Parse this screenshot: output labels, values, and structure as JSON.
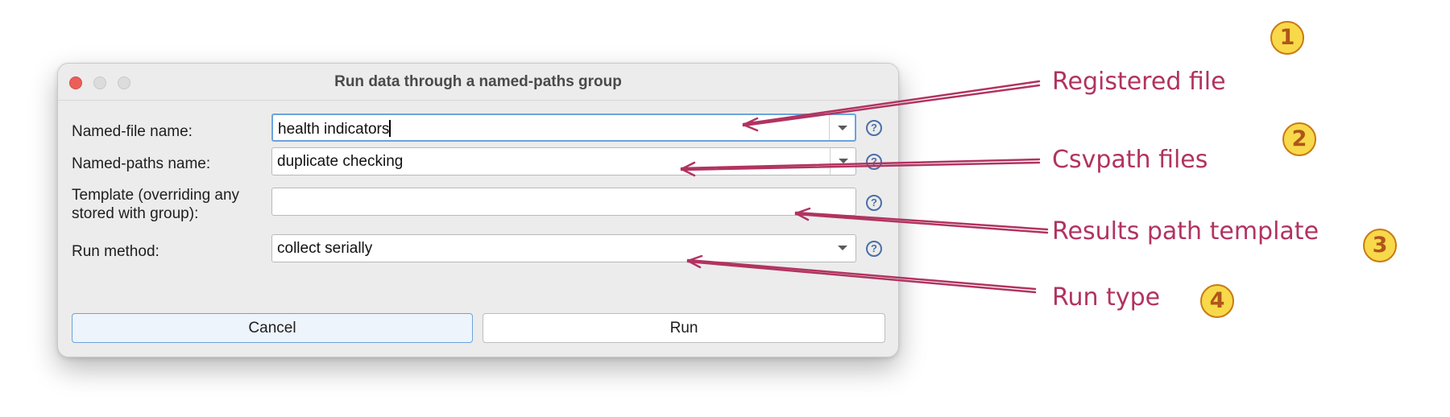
{
  "window": {
    "title": "Run data through a named-paths group"
  },
  "form": {
    "named_file": {
      "label": "Named-file name:",
      "value": "health indicators"
    },
    "named_paths": {
      "label": "Named-paths name:",
      "value": "duplicate checking"
    },
    "template": {
      "label_line1": "Template (overriding any",
      "label_line2": "stored with group):",
      "value": ""
    },
    "run_method": {
      "label": "Run method:",
      "value": "collect serially"
    },
    "help_glyph": "?"
  },
  "buttons": {
    "cancel": "Cancel",
    "run": "Run"
  },
  "annotations": [
    {
      "number": "1",
      "text": "Registered file"
    },
    {
      "number": "2",
      "text": "Csvpath files"
    },
    {
      "number": "3",
      "text": "Results path template"
    },
    {
      "number": "4",
      "text": "Run type"
    }
  ],
  "colors": {
    "annotation": "#b13360",
    "badge_fill": "#f8d94a",
    "focus_ring": "#6aa3de",
    "close_light": "#ec5f59"
  },
  "icons": [
    "help-icon",
    "dropdown-arrow-icon"
  ]
}
